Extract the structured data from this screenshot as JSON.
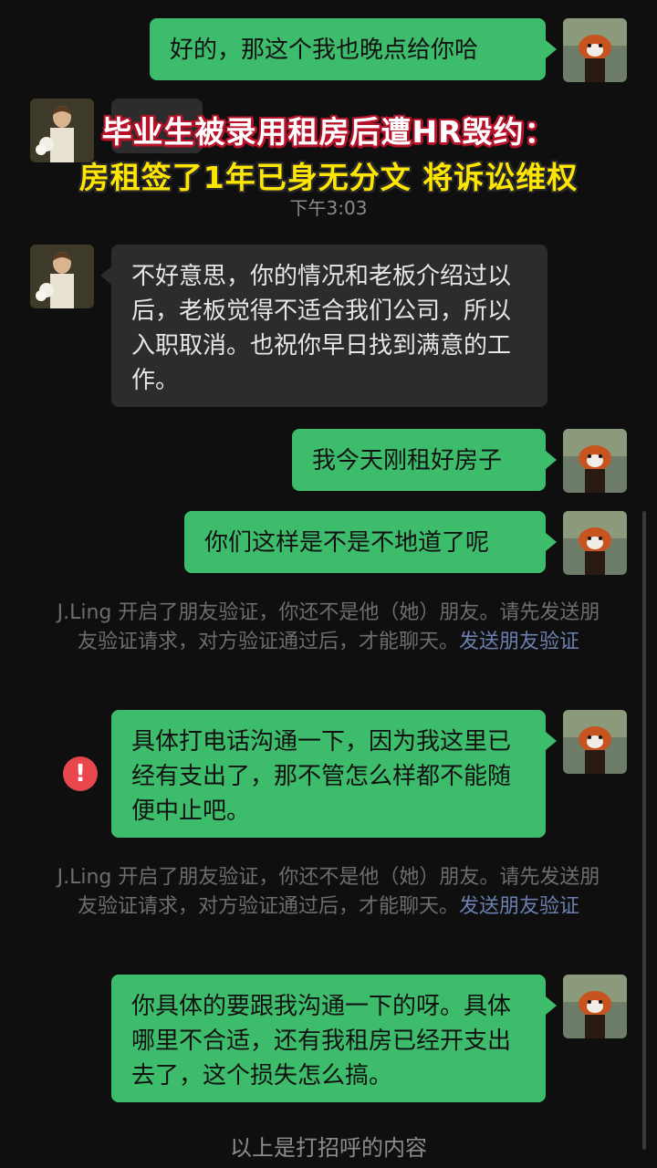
{
  "headline": {
    "line1": "毕业生被录用租房后遭HR毁约：",
    "line2": "房租签了1年已身无分文 将诉讼维权"
  },
  "timestamp": "下午3:03",
  "messages": [
    {
      "text": "好的，那这个我也晚点给你哈"
    },
    {
      "text": "不好意思，你的情况和老板介绍过以后，老板觉得不适合我们公司，所以入职取消。也祝你早日找到满意的工作。"
    },
    {
      "text": "我今天刚租好房子"
    },
    {
      "text": "你们这样是不是不地道了呢"
    },
    {
      "text": "具体打电话沟通一下，因为我这里已经有支出了，那不管怎么样都不能随便中止吧。"
    },
    {
      "text": "你具体的要跟我沟通一下的呀。具体哪里不合适，还有我租房已经开支出去了，这个损失怎么搞。"
    }
  ],
  "system_notice": {
    "text": "J.Ling 开启了朋友验证，你还不是他（她）朋友。请先发送朋友验证请求，对方验证通过后，才能聊天。",
    "link": "发送朋友验证"
  },
  "error_icon": "!",
  "footer_note": "以上是打招呼的内容",
  "colors": {
    "out_bubble": "#3dbc6c",
    "in_bubble": "#2c2c2c",
    "headline_outline": "#b8122b",
    "headline_line2": "#ffe600",
    "error": "#e9464e"
  }
}
